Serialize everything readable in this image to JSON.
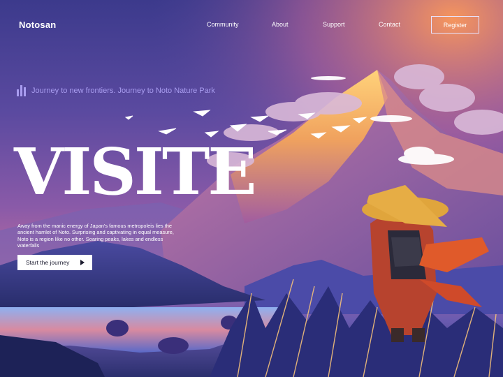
{
  "nav": {
    "brand": "Notosan",
    "links": [
      "Community",
      "About",
      "Support",
      "Contact"
    ],
    "register_label": "Register"
  },
  "hero": {
    "tagline": "Journey to new frontiers. Journey to Noto Nature Park",
    "title": "VISITE",
    "description_lines": [
      "Away from the manic energy of Japan's famous metropoleis  lies the",
      "ancient hamlet of Noto. Surprising and captivating in equal measure,",
      "Noto is a region like no other.  Soaring peaks, lakes and endless waterfalls"
    ],
    "cta_label": "Start the journey",
    "cta_icon": "play-icon",
    "tagline_icon": "bars-icon"
  },
  "colors": {
    "accent": "#a99df0",
    "sky_top": "#3c3a8c",
    "mountain_light": "#f3b15e"
  }
}
